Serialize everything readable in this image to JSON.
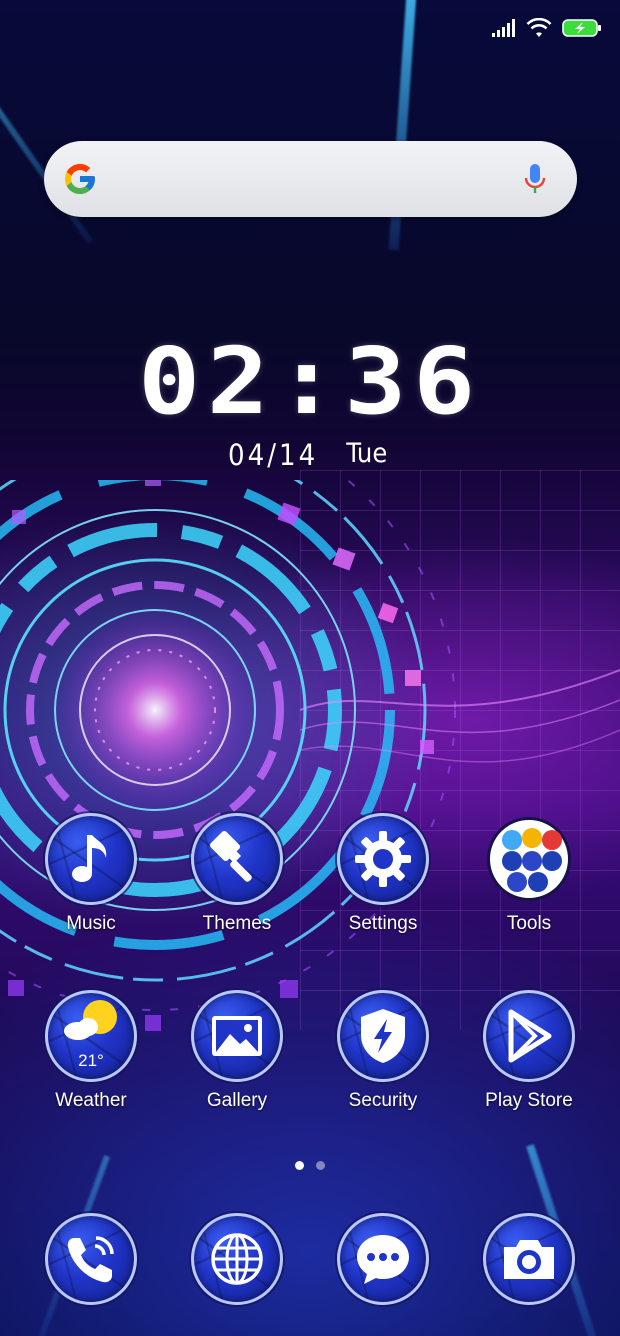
{
  "status_bar": {
    "signal_icon": "signal-bars-icon",
    "wifi_icon": "wifi-icon",
    "battery_icon": "battery-charging-icon",
    "battery_color": "#3ddc3d"
  },
  "search": {
    "logo_icon": "google-g-icon",
    "mic_icon": "microphone-icon",
    "placeholder": ""
  },
  "clock": {
    "time": "02:36",
    "date": "04/14",
    "weekday": "Tue"
  },
  "apps_row1": [
    {
      "label": "Music",
      "icon": "music-note-icon"
    },
    {
      "label": "Themes",
      "icon": "paintbrush-icon"
    },
    {
      "label": "Settings",
      "icon": "gear-icon"
    },
    {
      "label": "Tools",
      "icon": "folder-icon"
    }
  ],
  "apps_row2": [
    {
      "label": "Weather",
      "icon": "sun-cloud-icon",
      "temp": "21°"
    },
    {
      "label": "Gallery",
      "icon": "image-icon"
    },
    {
      "label": "Security",
      "icon": "shield-bolt-icon"
    },
    {
      "label": "Play Store",
      "icon": "play-store-icon"
    }
  ],
  "dock": [
    {
      "icon": "phone-icon"
    },
    {
      "icon": "globe-icon"
    },
    {
      "icon": "chat-bubble-icon"
    },
    {
      "icon": "camera-icon"
    }
  ],
  "pager": {
    "pages": 2,
    "active": 0
  },
  "colors": {
    "icon_blue": "#2034c8",
    "icon_border": "#b9c8ff",
    "text": "#ffffff"
  }
}
